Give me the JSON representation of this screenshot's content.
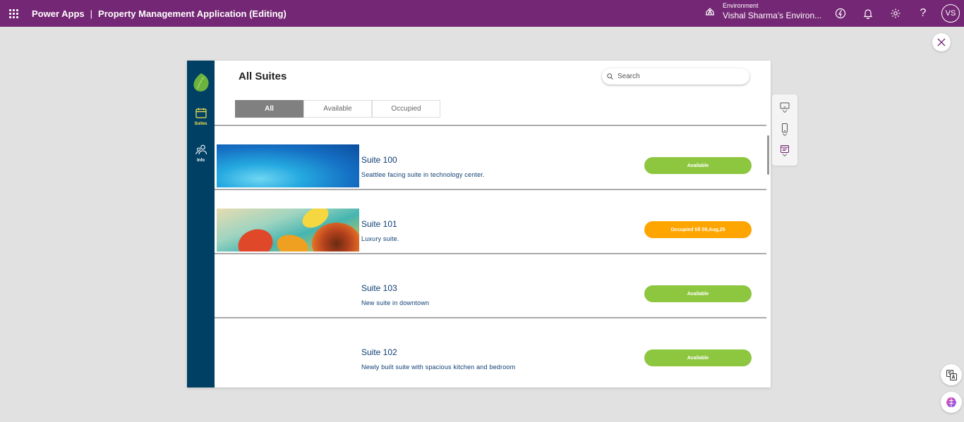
{
  "header": {
    "app_name": "Power Apps",
    "separator": "|",
    "app_title": "Property Management Application (Editing)",
    "environment_label": "Environment",
    "environment_name": "Vishal Sharma's Environ...",
    "avatar_initials": "VS",
    "icons": [
      "waffle-icon",
      "environment-icon",
      "copilot-icon",
      "bell-icon",
      "gear-icon",
      "help-icon"
    ]
  },
  "sidebar": {
    "items": [
      {
        "label": "Suites",
        "icon": "calendar-icon",
        "color": "#f5e54b"
      },
      {
        "label": "Info",
        "icon": "people-icon",
        "color": "#ffffff"
      }
    ]
  },
  "page": {
    "title": "All Suites",
    "search_placeholder": "Search",
    "tabs": [
      {
        "label": "All",
        "active": true
      },
      {
        "label": "Available",
        "active": false
      },
      {
        "label": "Occupied",
        "active": false
      }
    ]
  },
  "suites": [
    {
      "name": "Suite 100",
      "description": "Seattlee facing suite in technology center.",
      "status": "Available",
      "image": "blue"
    },
    {
      "name": "Suite 101",
      "description": "Luxury suite.",
      "status": "Occupied till 09,Aug,25",
      "image": "flower"
    },
    {
      "name": "Suite 103",
      "description": "New suite in downtown",
      "status": "Available",
      "image": "none"
    },
    {
      "name": "Suite 102",
      "description": "Newly built suite with spacious kitchen and bedroom",
      "status": "Available",
      "image": "none"
    }
  ],
  "colors": {
    "header_bg": "#742774",
    "sidebar_bg": "#004065",
    "available": "#8dc63f",
    "occupied": "#ffa500",
    "suite_text": "#0d3e73"
  }
}
